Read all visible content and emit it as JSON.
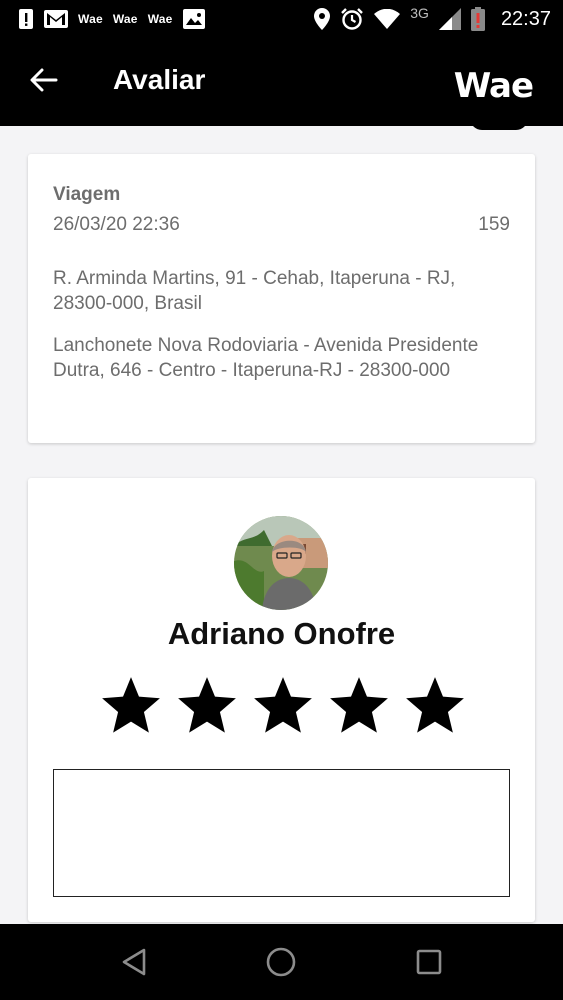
{
  "status_bar": {
    "notif_apps": [
      "Wae",
      "Wae",
      "Wae"
    ],
    "network": "3G",
    "time": "22:37"
  },
  "app_bar": {
    "title": "Avaliar",
    "brand": "Wae"
  },
  "trip": {
    "label": "Viagem",
    "datetime": "26/03/20 22:36",
    "number": "159",
    "origin": "R. Arminda Martins, 91 - Cehab, Itaperuna - RJ, 28300-000, Brasil",
    "destination": "Lanchonete Nova Rodoviaria - Avenida Presidente Dutra, 646 - Centro - Itaperuna-RJ - 28300-000"
  },
  "rating": {
    "driver_name": "Adriano Onofre",
    "stars_selected": 5,
    "stars_total": 5,
    "comment": ""
  },
  "colors": {
    "bar_background": "#000000",
    "page_background": "#f4f4f6",
    "secondary_text": "#6d6d6d",
    "star_color": "#000000"
  }
}
